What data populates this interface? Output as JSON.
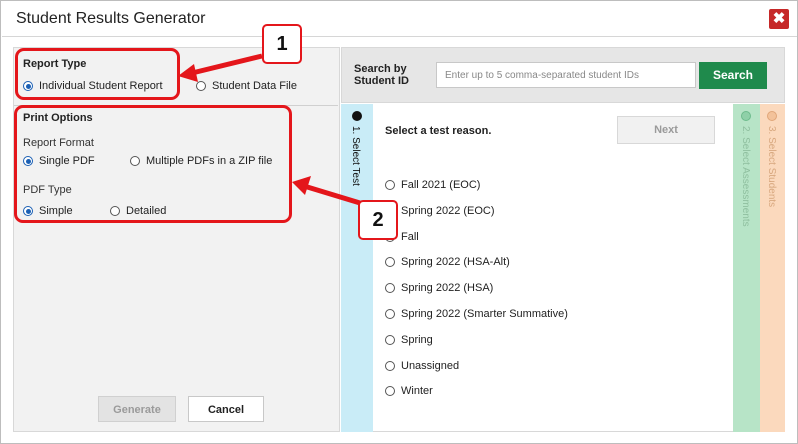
{
  "window": {
    "title": "Student Results Generator",
    "close_glyph": "✖"
  },
  "report_type": {
    "heading": "Report Type",
    "options": [
      {
        "label": "Individual Student Report",
        "selected": true
      },
      {
        "label": "Student Data File",
        "selected": false
      }
    ]
  },
  "print_options": {
    "heading": "Print Options",
    "report_format": {
      "label": "Report Format",
      "options": [
        {
          "label": "Single PDF",
          "selected": true
        },
        {
          "label": "Multiple PDFs in a ZIP file",
          "selected": false
        }
      ]
    },
    "pdf_type": {
      "label": "PDF Type",
      "options": [
        {
          "label": "Simple",
          "selected": true
        },
        {
          "label": "Detailed",
          "selected": false
        }
      ]
    }
  },
  "buttons": {
    "generate": "Generate",
    "cancel": "Cancel"
  },
  "search": {
    "label": "Search by Student ID",
    "placeholder": "Enter up to 5 comma-separated student IDs",
    "value": "",
    "button": "Search"
  },
  "steps": [
    {
      "label": "1. Select Test",
      "status": "active",
      "color": "#c9ecf7"
    },
    {
      "label": "2. Select Assessments",
      "status": "inactive",
      "color": "#b7e4c7"
    },
    {
      "label": "3. Select Students",
      "status": "inactive",
      "color": "#fbd9bd"
    }
  ],
  "test_reason": {
    "prompt": "Select a test reason.",
    "next_button": "Next",
    "options": [
      "Fall 2021 (EOC)",
      "Spring 2022 (EOC)",
      "Fall",
      "Spring 2022 (HSA-Alt)",
      "Spring 2022 (HSA)",
      "Spring 2022 (Smarter Summative)",
      "Spring",
      "Unassigned",
      "Winter"
    ]
  },
  "callouts": [
    {
      "number": "1"
    },
    {
      "number": "2"
    }
  ],
  "colors": {
    "accent_green": "#1f8a4c",
    "radio_blue": "#1a5fb4",
    "callout_red": "#e4161b",
    "close_red": "#c62828"
  }
}
